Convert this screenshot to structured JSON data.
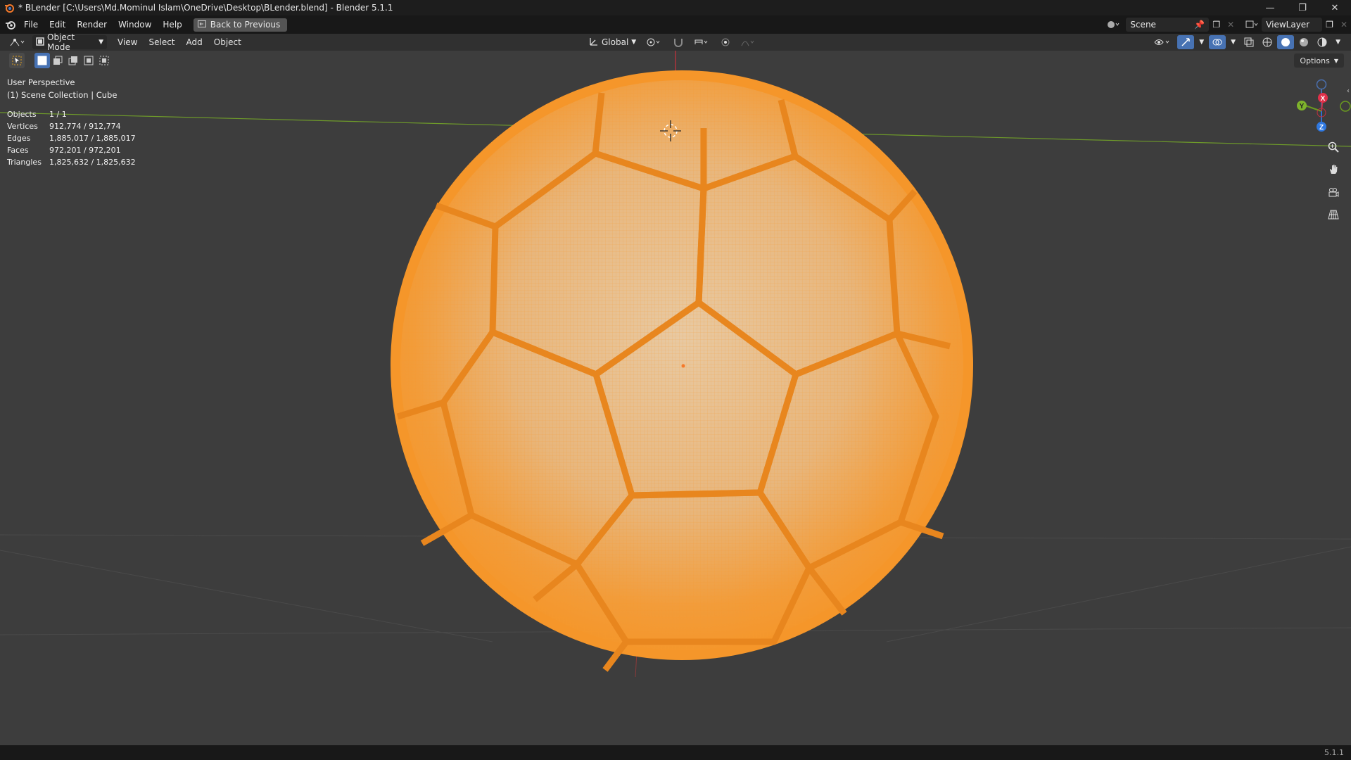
{
  "window": {
    "title": "* BLender [C:\\Users\\Md.Mominul Islam\\OneDrive\\Desktop\\BLender.blend] - Blender 5.1.1",
    "controls": {
      "minimize_icon": "minimize-icon",
      "restore_icon": "restore-icon",
      "close_icon": "close-icon"
    }
  },
  "menubar": {
    "items": [
      "File",
      "Edit",
      "Render",
      "Window",
      "Help"
    ],
    "back_button": "Back to Previous",
    "scene": "Scene",
    "view_layer": "ViewLayer"
  },
  "header": {
    "mode": "Object Mode",
    "menus": [
      "View",
      "Select",
      "Add",
      "Object"
    ],
    "transform_orientation": "Global"
  },
  "toolbar": {
    "options": "Options"
  },
  "viewport": {
    "perspective": "User Perspective",
    "collection": "(1) Scene Collection | Cube",
    "stats": [
      {
        "label": "Objects",
        "value": "1 / 1"
      },
      {
        "label": "Vertices",
        "value": "912,774 / 912,774"
      },
      {
        "label": "Edges",
        "value": "1,885,017 / 1,885,017"
      },
      {
        "label": "Faces",
        "value": "972,201 / 972,201"
      },
      {
        "label": "Triangles",
        "value": "1,825,632 / 1,825,632"
      }
    ],
    "gizmo": {
      "x": "X",
      "y": "Y",
      "z": "Z"
    },
    "object_color": "#f5962a",
    "background_color": "#3d3d3d"
  },
  "statusbar": {
    "version": "5.1.1"
  }
}
